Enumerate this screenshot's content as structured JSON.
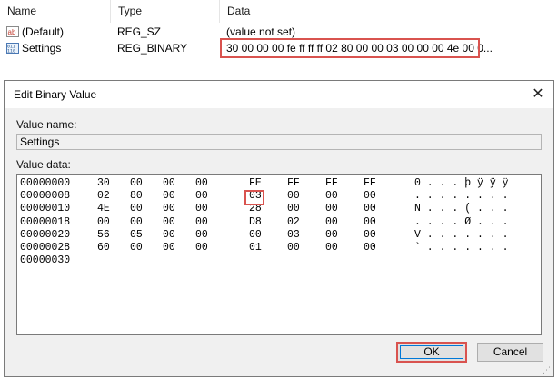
{
  "list": {
    "columns": [
      "Name",
      "Type",
      "Data"
    ],
    "rows": [
      {
        "icon": "string-value-icon",
        "name": "(Default)",
        "type": "REG_SZ",
        "data": "(value not set)"
      },
      {
        "icon": "binary-value-icon",
        "name": "Settings",
        "type": "REG_BINARY",
        "data": "30 00 00 00 fe ff ff ff 02 80 00 00 03 00 00 00 4e 00 0..."
      }
    ]
  },
  "dialog": {
    "title": "Edit Binary Value",
    "close_glyph": "✕",
    "value_name_label": "Value name:",
    "value_name": "Settings",
    "value_data_label": "Value data:",
    "hex_rows": [
      {
        "offset": "00000000",
        "bytes": [
          "30",
          "00",
          "00",
          "00",
          "FE",
          "FF",
          "FF",
          "FF"
        ],
        "ascii": "0 . . . þ ÿ ÿ ÿ"
      },
      {
        "offset": "00000008",
        "bytes": [
          "02",
          "80",
          "00",
          "00",
          "03",
          "00",
          "00",
          "00"
        ],
        "ascii": ". . . . . . . ."
      },
      {
        "offset": "00000010",
        "bytes": [
          "4E",
          "00",
          "00",
          "00",
          "28",
          "00",
          "00",
          "00"
        ],
        "ascii": "N . . . ( . . ."
      },
      {
        "offset": "00000018",
        "bytes": [
          "00",
          "00",
          "00",
          "00",
          "D8",
          "02",
          "00",
          "00"
        ],
        "ascii": ". . . . Ø . . ."
      },
      {
        "offset": "00000020",
        "bytes": [
          "56",
          "05",
          "00",
          "00",
          "00",
          "03",
          "00",
          "00"
        ],
        "ascii": "V . . . . . . ."
      },
      {
        "offset": "00000028",
        "bytes": [
          "60",
          "00",
          "00",
          "00",
          "01",
          "00",
          "00",
          "00"
        ],
        "ascii": "` . . . . . . ."
      },
      {
        "offset": "00000030",
        "bytes": [],
        "ascii": ""
      }
    ],
    "ok_label": "OK",
    "cancel_label": "Cancel"
  },
  "colors": {
    "highlight": "#d9534f",
    "focus": "#0078d7"
  }
}
